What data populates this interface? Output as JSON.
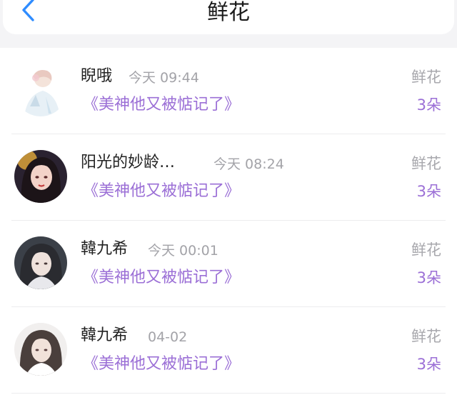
{
  "header": {
    "title": "鲜花"
  },
  "records": [
    {
      "name": "睨哦",
      "time": "今天 09:44",
      "book": "《美神他又被惦记了》",
      "gift_label": "鲜花",
      "gift_count": "3朵"
    },
    {
      "name": "阳光的妙龄…",
      "time": "今天 08:24",
      "book": "《美神他又被惦记了》",
      "gift_label": "鲜花",
      "gift_count": "3朵"
    },
    {
      "name": "韓九希",
      "time": "今天 00:01",
      "book": "《美神他又被惦记了》",
      "gift_label": "鲜花",
      "gift_count": "3朵"
    },
    {
      "name": "韓九希",
      "time": "04-02",
      "book": "《美神他又被惦记了》",
      "gift_label": "鲜花",
      "gift_count": "3朵"
    }
  ],
  "colors": {
    "accent_purple": "#9b6fd6",
    "back_icon_blue": "#2f8cff",
    "muted_gray": "#a3a3a8"
  }
}
